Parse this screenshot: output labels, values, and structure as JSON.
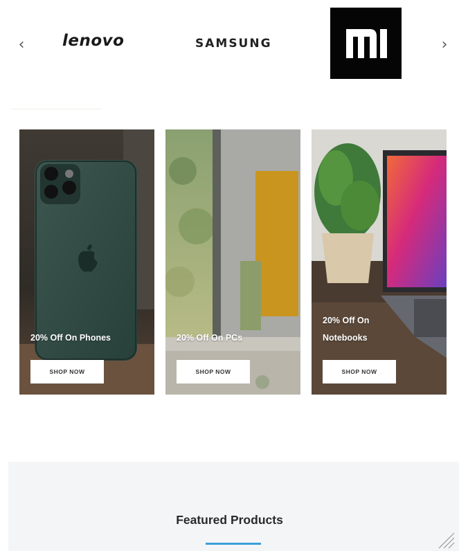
{
  "brands": {
    "prev_arrow": "‹",
    "next_arrow": "›",
    "items": [
      {
        "name": "lenovo"
      },
      {
        "name": "SAMSUNG"
      },
      {
        "name": "Mi"
      }
    ]
  },
  "promos": [
    {
      "label": "20% Off On Phones",
      "button": "SHOP NOW"
    },
    {
      "label": "20% Off On PCs",
      "button": "SHOP NOW"
    },
    {
      "label_line1": "20% Off On",
      "label_line2": "Notebooks",
      "button": "SHOP NOW"
    }
  ],
  "featured": {
    "title": "Featured Products",
    "accent_color": "#3a9fd8"
  }
}
